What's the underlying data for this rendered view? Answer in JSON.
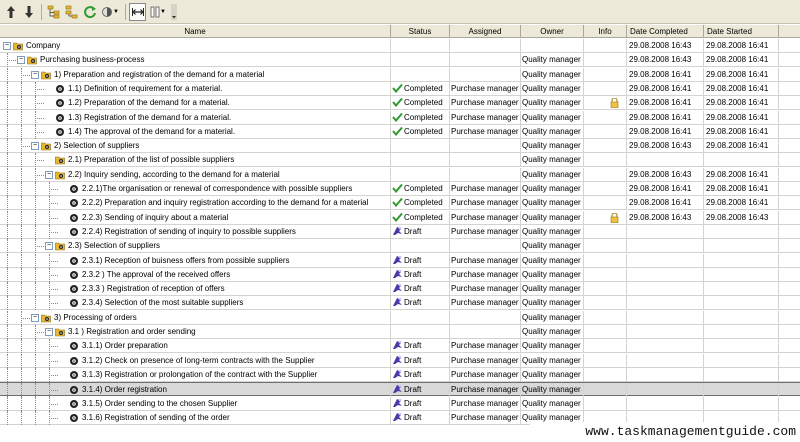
{
  "toolbar": {
    "buttons": [
      {
        "name": "move-up-icon"
      },
      {
        "name": "move-down-icon"
      },
      {
        "name": "indent-icon"
      },
      {
        "name": "outdent-icon"
      },
      {
        "name": "refresh-icon"
      },
      {
        "name": "view-options-icon"
      },
      {
        "name": "fit-width-icon"
      },
      {
        "name": "columns-icon"
      },
      {
        "name": "more-icon"
      }
    ]
  },
  "columns": {
    "name": "Name",
    "status": "Status",
    "assigned": "Assigned",
    "owner": "Owner",
    "info": "Info",
    "date_completed": "Date Completed",
    "date_started": "Date Started"
  },
  "rows": [
    {
      "level": 0,
      "kind": "folder",
      "expanded": true,
      "name": "Company",
      "status": "",
      "assigned": "",
      "owner": "",
      "info": "",
      "date_completed": "29.08.2008 16:43",
      "date_started": "29.08.2008 16:41"
    },
    {
      "level": 1,
      "kind": "folder",
      "expanded": true,
      "name": "Purchasing business-process",
      "status": "",
      "assigned": "",
      "owner": "Quality manager",
      "info": "",
      "date_completed": "29.08.2008 16:43",
      "date_started": "29.08.2008 16:41"
    },
    {
      "level": 2,
      "kind": "folder",
      "expanded": true,
      "name": "1) Preparation and registration of the demand for a material",
      "status": "",
      "assigned": "",
      "owner": "Quality manager",
      "info": "",
      "date_completed": "29.08.2008 16:41",
      "date_started": "29.08.2008 16:41"
    },
    {
      "level": 3,
      "kind": "task",
      "name": "1.1) Definition of requirement for a material.",
      "status": "Completed",
      "status_kind": "completed",
      "assigned": "Purchase manager",
      "owner": "Quality manager",
      "info": "",
      "date_completed": "29.08.2008 16:41",
      "date_started": "29.08.2008 16:41"
    },
    {
      "level": 3,
      "kind": "task",
      "name": "1.2) Preparation of the demand for a material.",
      "status": "Completed",
      "status_kind": "completed",
      "assigned": "Purchase manager",
      "owner": "Quality manager",
      "info": "lock",
      "date_completed": "29.08.2008 16:41",
      "date_started": "29.08.2008 16:41"
    },
    {
      "level": 3,
      "kind": "task",
      "name": "1.3) Registration of the demand for a material.",
      "status": "Completed",
      "status_kind": "completed",
      "assigned": "Purchase manager",
      "owner": "Quality manager",
      "info": "",
      "date_completed": "29.08.2008 16:41",
      "date_started": "29.08.2008 16:41"
    },
    {
      "level": 3,
      "kind": "task",
      "name": "1.4) The approval  of the demand for a material.",
      "status": "Completed",
      "status_kind": "completed",
      "assigned": "Purchase manager",
      "owner": "Quality manager",
      "info": "",
      "date_completed": "29.08.2008 16:41",
      "date_started": "29.08.2008 16:41"
    },
    {
      "level": 2,
      "kind": "folder",
      "expanded": true,
      "name": "2) Selection of suppliers",
      "status": "",
      "assigned": "",
      "owner": "Quality manager",
      "info": "",
      "date_completed": "29.08.2008 16:43",
      "date_started": "29.08.2008 16:41"
    },
    {
      "level": 3,
      "kind": "folder-leaf",
      "name": "2.1) Preparation of the list of possible suppliers",
      "status": "",
      "assigned": "",
      "owner": "Quality manager",
      "info": "",
      "date_completed": "",
      "date_started": ""
    },
    {
      "level": 3,
      "kind": "folder",
      "expanded": true,
      "name": "2.2) Inquiry sending, according to the demand for a material",
      "status": "",
      "assigned": "",
      "owner": "Quality manager",
      "info": "",
      "date_completed": "29.08.2008 16:43",
      "date_started": "29.08.2008 16:41"
    },
    {
      "level": 4,
      "kind": "task",
      "name": "2.2.1)The organisation or renewal of correspondence with possible suppliers",
      "status": "Completed",
      "status_kind": "completed",
      "assigned": "Purchase manager",
      "owner": "Quality manager",
      "info": "",
      "date_completed": "29.08.2008 16:41",
      "date_started": "29.08.2008 16:41"
    },
    {
      "level": 4,
      "kind": "task",
      "name": "2.2.2) Preparation and inquiry registration according to the demand for a material",
      "status": "Completed",
      "status_kind": "completed",
      "assigned": "Purchase manager",
      "owner": "Quality manager",
      "info": "",
      "date_completed": "29.08.2008 16:41",
      "date_started": "29.08.2008 16:41"
    },
    {
      "level": 4,
      "kind": "task",
      "name": "2.2.3) Sending of inquiry about a material",
      "status": "Completed",
      "status_kind": "completed",
      "assigned": "Purchase manager",
      "owner": "Quality manager",
      "info": "lock",
      "date_completed": "29.08.2008 16:43",
      "date_started": "29.08.2008 16:43"
    },
    {
      "level": 4,
      "kind": "task",
      "name": "2.2.4) Registration of sending of inquiry to possible suppliers",
      "status": "Draft",
      "status_kind": "draft",
      "assigned": "Purchase manager",
      "owner": "Quality manager",
      "info": "",
      "date_completed": "",
      "date_started": ""
    },
    {
      "level": 3,
      "kind": "folder",
      "expanded": true,
      "name": "2.3) Selection of suppliers",
      "status": "",
      "assigned": "",
      "owner": "Quality manager",
      "info": "",
      "date_completed": "",
      "date_started": ""
    },
    {
      "level": 4,
      "kind": "task",
      "name": "2.3.1) Reception of buisness offers from possible suppliers",
      "status": "Draft",
      "status_kind": "draft",
      "assigned": "Purchase manager",
      "owner": "Quality manager",
      "info": "",
      "date_completed": "",
      "date_started": ""
    },
    {
      "level": 4,
      "kind": "task",
      "name": "2.3.2 ) The approval of the received offers",
      "status": "Draft",
      "status_kind": "draft",
      "assigned": "Purchase manager",
      "owner": "Quality manager",
      "info": "",
      "date_completed": "",
      "date_started": ""
    },
    {
      "level": 4,
      "kind": "task",
      "name": "2.3.3 ) Registration of reception of offers",
      "status": "Draft",
      "status_kind": "draft",
      "assigned": "Purchase manager",
      "owner": "Quality manager",
      "info": "",
      "date_completed": "",
      "date_started": ""
    },
    {
      "level": 4,
      "kind": "task",
      "name": "2.3.4) Selection of the most suitable suppliers",
      "status": "Draft",
      "status_kind": "draft",
      "assigned": "Purchase manager",
      "owner": "Quality manager",
      "info": "",
      "date_completed": "",
      "date_started": ""
    },
    {
      "level": 2,
      "kind": "folder",
      "expanded": true,
      "name": "3) Processing of orders",
      "status": "",
      "assigned": "",
      "owner": "Quality manager",
      "info": "",
      "date_completed": "",
      "date_started": ""
    },
    {
      "level": 3,
      "kind": "folder",
      "expanded": true,
      "name": "3.1 ) Registration and order sending",
      "status": "",
      "assigned": "",
      "owner": "Quality manager",
      "info": "",
      "date_completed": "",
      "date_started": ""
    },
    {
      "level": 4,
      "kind": "task",
      "name": "3.1.1) Order preparation",
      "status": "Draft",
      "status_kind": "draft",
      "assigned": "Purchase manager",
      "owner": "Quality manager",
      "info": "",
      "date_completed": "",
      "date_started": ""
    },
    {
      "level": 4,
      "kind": "task",
      "name": "3.1.2) Check on presence of long-term contracts with the Supplier",
      "status": "Draft",
      "status_kind": "draft",
      "assigned": "Purchase manager",
      "owner": "Quality manager",
      "info": "",
      "date_completed": "",
      "date_started": ""
    },
    {
      "level": 4,
      "kind": "task",
      "name": "3.1.3) Registration or prolongation of the contract with the Supplier",
      "status": "Draft",
      "status_kind": "draft",
      "assigned": "Purchase manager",
      "owner": "Quality manager",
      "info": "",
      "date_completed": "",
      "date_started": ""
    },
    {
      "level": 4,
      "kind": "task",
      "selected": true,
      "name": "3.1.4) Order registration",
      "status": "Draft",
      "status_kind": "draft",
      "assigned": "Purchase manager",
      "owner": "Quality manager",
      "info": "",
      "date_completed": "",
      "date_started": ""
    },
    {
      "level": 4,
      "kind": "task",
      "name": "3.1.5) Order sending to the chosen Supplier",
      "status": "Draft",
      "status_kind": "draft",
      "assigned": "Purchase manager",
      "owner": "Quality manager",
      "info": "",
      "date_completed": "",
      "date_started": ""
    },
    {
      "level": 4,
      "kind": "task",
      "name": "3.1.6) Registration of sending of the order",
      "status": "Draft",
      "status_kind": "draft",
      "assigned": "Purchase manager",
      "owner": "Quality manager",
      "info": "",
      "date_completed": "",
      "date_started": ""
    }
  ],
  "watermark": "www.taskmanagementguide.com",
  "colors": {
    "toolbar_bg": "#ece9d8",
    "completed_check": "#2e9b2e",
    "draft_icon": "#4a3aa8",
    "folder": "#e8b830",
    "selected_row": "#d9d9d9"
  }
}
